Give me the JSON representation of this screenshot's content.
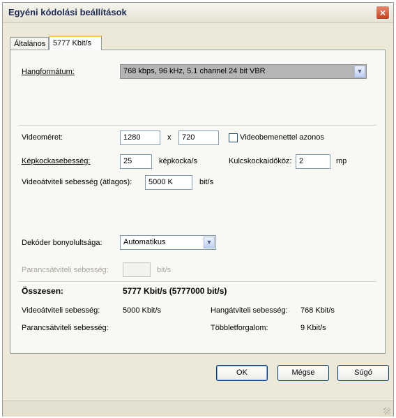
{
  "window": {
    "title": "Egyéni kódolási beállítások",
    "close_glyph": "×"
  },
  "tabs": [
    {
      "label": "Általános"
    },
    {
      "label": "5777 Kbit/s"
    }
  ],
  "audio": {
    "label": "Hangformátum:",
    "value": "768 kbps, 96 kHz, 5.1 channel 24 bit VBR"
  },
  "video_size": {
    "label": "Videoméret:",
    "width": "1280",
    "x": "x",
    "height": "720",
    "checkbox_label": "Videobemenettel azonos",
    "checked": false
  },
  "framerate": {
    "label": "Képkockasebesség:",
    "value": "25",
    "unit": "képkocka/s"
  },
  "keyframe": {
    "label": "Kulcskockaidőköz:",
    "value": "2",
    "unit": "mp"
  },
  "video_bitrate": {
    "label": "Videoátviteli sebesség (átlagos):",
    "value": "5000 K",
    "unit": "bit/s"
  },
  "decoder": {
    "label": "Dekóder bonyolultsága:",
    "value": "Automatikus"
  },
  "command_bitrate": {
    "label": "Parancsátviteli sebesség:",
    "value": "",
    "unit": "bit/s"
  },
  "summary": {
    "label": "Összesen:",
    "value": "5777 Kbit/s (5777000 bit/s)",
    "video_label": "Videoátviteli sebesség:",
    "video_value": "5000 Kbit/s",
    "audio_label": "Hangátviteli sebesség:",
    "audio_value": "768 Kbit/s",
    "command_label": "Parancsátviteli sebesség:",
    "overhead_label": "Többletforgalom:",
    "overhead_value": "9 Kbit/s"
  },
  "buttons": {
    "ok": "OK",
    "cancel": "Mégse",
    "help": "Súgó"
  },
  "colors": {
    "close_button": "#c7421f",
    "active_tab_accent": "#ffc83c",
    "focused_button_border": "#7ba0e4"
  },
  "icons": {
    "close": "close-icon",
    "dropdown": "chevron-down-icon",
    "grip": "resize-grip-icon"
  }
}
